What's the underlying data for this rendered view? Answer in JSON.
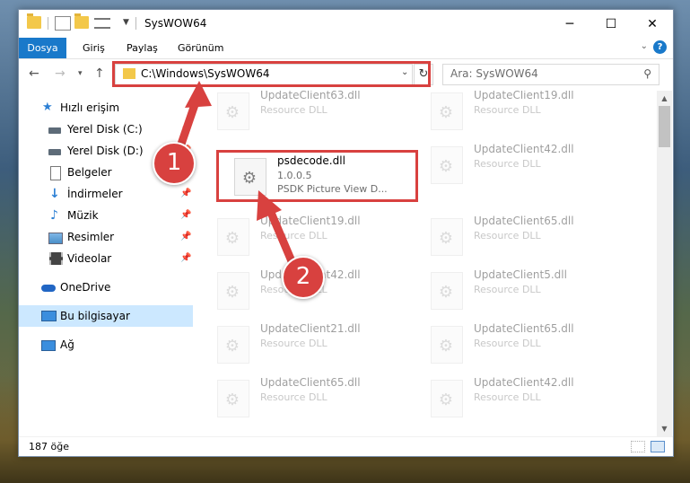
{
  "window": {
    "title": "SysWOW64",
    "controls": {
      "minimize": "─",
      "maximize": "☐",
      "close": "✕"
    }
  },
  "ribbon": {
    "tabs": [
      {
        "label": "Dosya"
      },
      {
        "label": "Giriş"
      },
      {
        "label": "Paylaş"
      },
      {
        "label": "Görünüm"
      }
    ],
    "help": "?"
  },
  "address_bar": {
    "path": "C:\\Windows\\SysWOW64",
    "search_placeholder": "Ara: SysWOW64"
  },
  "sidebar": {
    "items": [
      {
        "label": "Hızlı erişim",
        "icon": "star-icon"
      },
      {
        "label": "Yerel Disk (C:)",
        "icon": "drive-icon",
        "pinned": true
      },
      {
        "label": "Yerel Disk (D:)",
        "icon": "drive-icon",
        "pinned": true
      },
      {
        "label": "Belgeler",
        "icon": "documents-icon",
        "pinned": true
      },
      {
        "label": "İndirmeler",
        "icon": "downloads-icon",
        "pinned": true
      },
      {
        "label": "Müzik",
        "icon": "music-icon",
        "pinned": true
      },
      {
        "label": "Resimler",
        "icon": "pictures-icon",
        "pinned": true
      },
      {
        "label": "Videolar",
        "icon": "videos-icon",
        "pinned": true
      },
      {
        "label": "OneDrive",
        "icon": "cloud-icon"
      },
      {
        "label": "Bu bilgisayar",
        "icon": "computer-icon"
      },
      {
        "label": "Ağ",
        "icon": "network-icon"
      }
    ]
  },
  "files": [
    {
      "name": "UpdateClient63.dll",
      "line2": "Resource DLL",
      "line3": ""
    },
    {
      "name": "UpdateClient19.dll",
      "line2": "Resource DLL",
      "line3": ""
    },
    {
      "name": "psdecode.dll",
      "line2": "1.0.0.5",
      "line3": "PSDK Picture View D..."
    },
    {
      "name": "UpdateClient42.dll",
      "line2": "Resource DLL",
      "line3": ""
    },
    {
      "name": "UpdateClient19.dll",
      "line2": "Resource DLL",
      "line3": ""
    },
    {
      "name": "UpdateClient65.dll",
      "line2": "Resource DLL",
      "line3": ""
    },
    {
      "name": "UpdateClient42.dll",
      "line2": "Resource DLL",
      "line3": ""
    },
    {
      "name": "UpdateClient5.dll",
      "line2": "Resource DLL",
      "line3": ""
    },
    {
      "name": "UpdateClient21.dll",
      "line2": "Resource DLL",
      "line3": ""
    },
    {
      "name": "UpdateClient65.dll",
      "line2": "Resource DLL",
      "line3": ""
    },
    {
      "name": "UpdateClient65.dll",
      "line2": "Resource DLL",
      "line3": ""
    },
    {
      "name": "UpdateClient42.dll",
      "line2": "Resource DLL",
      "line3": ""
    }
  ],
  "status": {
    "item_count": "187 öğe"
  },
  "annotations": {
    "step1": "1",
    "step2": "2",
    "color": "#d8413f"
  }
}
